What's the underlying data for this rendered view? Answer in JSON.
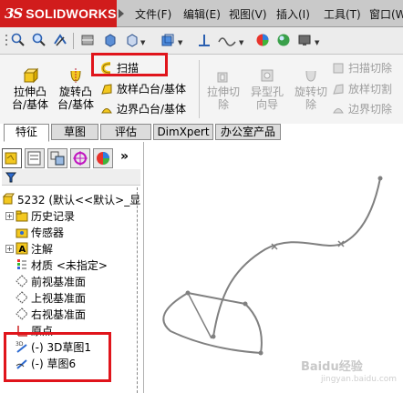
{
  "app": {
    "logo_ds": "3S",
    "logo_name": "SOLIDWORKS"
  },
  "menu": [
    "文件(F)",
    "编辑(E)",
    "视图(V)",
    "插入(I)",
    "工具(T)",
    "窗口(W)"
  ],
  "features": {
    "extrude_boss": [
      "拉伸凸",
      "台/基体"
    ],
    "revolve_boss": [
      "旋转凸",
      "台/基体"
    ],
    "sweep": "扫描",
    "loft": "放样凸台/基体",
    "boundary": "边界凸台/基体",
    "extrude_cut": [
      "拉伸切",
      "除"
    ],
    "hole_wizard": [
      "异型孔",
      "向导"
    ],
    "revolve_cut": [
      "旋转切",
      "除"
    ],
    "sweep_cut": "扫描切除",
    "loft_cut": "放样切割",
    "boundary_cut": "边界切除"
  },
  "tabs": [
    "特征",
    "草图",
    "评估",
    "DimXpert",
    "办公室产品"
  ],
  "tree": {
    "root": "5232  (默认<<默认>_显",
    "items": [
      "历史记录",
      "传感器",
      "注解",
      "材质 <未指定>",
      "前视基准面",
      "上视基准面",
      "右视基准面",
      "原点",
      "(-) 3D草图1",
      "(-) 草图6"
    ]
  },
  "watermark": {
    "main": "Baidu经验",
    "sub": "jingyan.baidu.com"
  },
  "colors": {
    "highlight": "#e0141b",
    "logo_bg": "#d11c1c",
    "sketch_line": "#808080"
  }
}
